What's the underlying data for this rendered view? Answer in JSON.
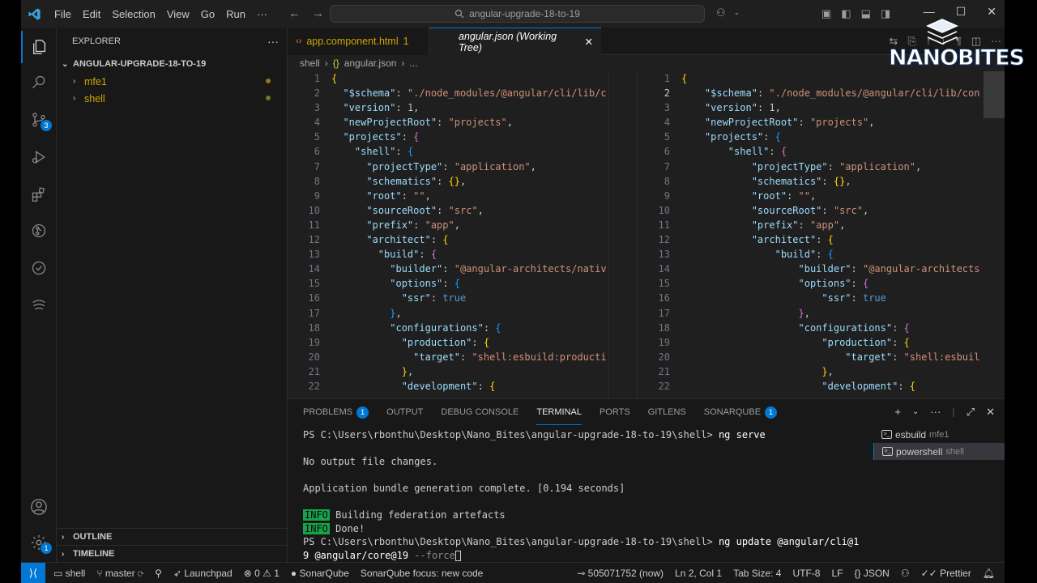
{
  "titlebar": {
    "menu": [
      "File",
      "Edit",
      "Selection",
      "View",
      "Go",
      "Run",
      "···"
    ],
    "search": "angular-upgrade-18-to-19"
  },
  "activity": {
    "scm_badge": "3",
    "settings_badge": "1"
  },
  "sidebar": {
    "title": "EXPLORER",
    "folder": "ANGULAR-UPGRADE-18-TO-19",
    "items": [
      "mfe1",
      "shell"
    ],
    "outline": "OUTLINE",
    "timeline": "TIMELINE"
  },
  "tabs": {
    "tab1_label": "app.component.html",
    "tab1_count": "1",
    "tab2_label": "angular.json (Working Tree)"
  },
  "breadcrumb": {
    "folder": "shell",
    "file": "angular.json",
    "more": "..."
  },
  "editor": {
    "line_numbers": [
      "1",
      "2",
      "3",
      "4",
      "5",
      "6",
      "7",
      "8",
      "9",
      "10",
      "11",
      "12",
      "13",
      "14",
      "15",
      "16",
      "17",
      "18",
      "19",
      "20",
      "21",
      "22"
    ],
    "left_lines": [
      "{",
      "  \"$schema\": \"./node_modules/@angular/cli/lib/c",
      "  \"version\": 1,",
      "  \"newProjectRoot\": \"projects\",",
      "  \"projects\": {",
      "    \"shell\": {",
      "      \"projectType\": \"application\",",
      "      \"schematics\": {},",
      "      \"root\": \"\",",
      "      \"sourceRoot\": \"src\",",
      "      \"prefix\": \"app\",",
      "      \"architect\": {",
      "        \"build\": {",
      "          \"builder\": \"@angular-architects/nativ",
      "          \"options\": {",
      "            \"ssr\": true",
      "          },",
      "          \"configurations\": {",
      "            \"production\": {",
      "              \"target\": \"shell:esbuild:producti",
      "            },",
      "            \"development\": {"
    ],
    "right_lines": [
      "{",
      "    \"$schema\": \"./node_modules/@angular/cli/lib/con",
      "    \"version\": 1,",
      "    \"newProjectRoot\": \"projects\",",
      "    \"projects\": {",
      "        \"shell\": {",
      "            \"projectType\": \"application\",",
      "            \"schematics\": {},",
      "            \"root\": \"\",",
      "            \"sourceRoot\": \"src\",",
      "            \"prefix\": \"app\",",
      "            \"architect\": {",
      "                \"build\": {",
      "                    \"builder\": \"@angular-architects",
      "                    \"options\": {",
      "                        \"ssr\": true",
      "                    },",
      "                    \"configurations\": {",
      "                        \"production\": {",
      "                            \"target\": \"shell:esbuil",
      "                        },",
      "                        \"development\": {"
    ]
  },
  "panel": {
    "tabs": [
      "PROBLEMS",
      "OUTPUT",
      "DEBUG CONSOLE",
      "TERMINAL",
      "PORTS",
      "GITLENS",
      "SONARQUBE"
    ],
    "problems_badge": "1",
    "sonar_badge": "1",
    "terminal": {
      "prompt1": "PS C:\\Users\\rbonthu\\Desktop\\Nano_Bites\\angular-upgrade-18-to-19\\shell> ",
      "cmd1": "ng serve",
      "out1": "No output file changes.",
      "out2": "Application bundle generation complete. [0.194 seconds]",
      "info_tag": "INFO",
      "info1": " Building federation artefacts",
      "info2": " Done!",
      "prompt2": "PS C:\\Users\\rbonthu\\Desktop\\Nano_Bites\\angular-upgrade-18-to-19\\shell> ",
      "cmd2": "ng update @angular/cli@1",
      "cmd2_cont": "9 @angular/core@19 ",
      "suggest": "--force"
    },
    "terminals": [
      {
        "name": "esbuild",
        "folder": "mfe1"
      },
      {
        "name": "powershell",
        "folder": "shell"
      }
    ]
  },
  "status": {
    "folder": "shell",
    "branch": "master",
    "launchpad": "Launchpad",
    "errors": "0",
    "warnings": "1",
    "sonar": "SonarQube",
    "sonar_focus": "SonarQube focus: new code",
    "commit": "505071752 (now)",
    "position": "Ln 2, Col 1",
    "tab_size": "Tab Size: 4",
    "encoding": "UTF-8",
    "eol": "LF",
    "language": "JSON",
    "prettier": "Prettier"
  },
  "logo": {
    "text": "NANOBITES"
  },
  "colors": {
    "accent": "#0078d4",
    "modified": "#cca700",
    "info_bg": "#16a34a"
  }
}
